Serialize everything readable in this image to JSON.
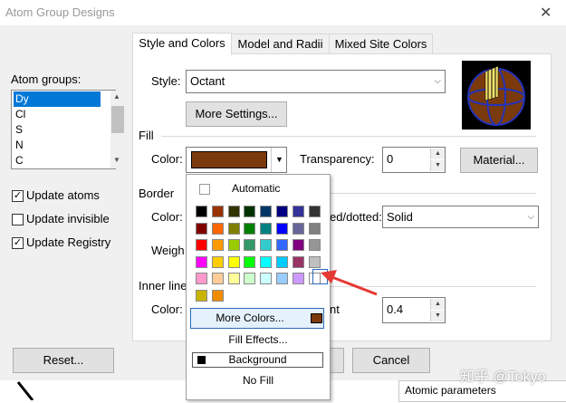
{
  "window": {
    "title": "Atom Group Designs",
    "close_icon": "close-icon"
  },
  "tabs": [
    {
      "label": "Style and Colors",
      "active": true
    },
    {
      "label": "Model and Radii",
      "active": false
    },
    {
      "label": "Mixed Site Colors",
      "active": false
    }
  ],
  "left": {
    "atom_groups_label": "Atom groups:",
    "groups": [
      "Dy",
      "Cl",
      "S",
      "N",
      "C"
    ],
    "selected_group": "Dy",
    "checkboxes": [
      {
        "label": "Update atoms",
        "checked": true
      },
      {
        "label": "Update invisible",
        "checked": false
      },
      {
        "label": "Update Registry",
        "checked": true
      }
    ],
    "reset_button": "Reset..."
  },
  "style": {
    "label": "Style:",
    "value": "Octant"
  },
  "more_settings_button": "More Settings...",
  "fill": {
    "section": "Fill",
    "color_label": "Color:",
    "color_value": "#7b3a0b",
    "transparency_label": "Transparency:",
    "transparency_value": "0",
    "material_button": "Material..."
  },
  "border": {
    "section": "Border",
    "color_label": "Color:",
    "dotted_label": "ed/dotted:",
    "dotted_value": "Solid",
    "weight_label": "Weigh"
  },
  "inner_lines": {
    "section": "Inner line",
    "color_label": "Color:",
    "partial_label": "nt",
    "value": "0.4"
  },
  "cancel_button": "Cancel",
  "color_popup": {
    "automatic": "Automatic",
    "rows": [
      [
        "#000000",
        "#993300",
        "#333300",
        "#003300",
        "#003366",
        "#000080",
        "#333399",
        "#333333"
      ],
      [
        "#800000",
        "#ff6600",
        "#808000",
        "#008000",
        "#008080",
        "#0000ff",
        "#666699",
        "#808080"
      ],
      [
        "#ff0000",
        "#ff9900",
        "#99cc00",
        "#339966",
        "#33cccc",
        "#3366ff",
        "#800080",
        "#969696"
      ],
      [
        "#ff00ff",
        "#ffcc00",
        "#ffff00",
        "#00ff00",
        "#00ffff",
        "#00ccff",
        "#993366",
        "#c0c0c0"
      ],
      [
        "#ff99cc",
        "#ffcc99",
        "#ffff99",
        "#ccffcc",
        "#ccffff",
        "#99ccff",
        "#cc99ff",
        "#ffffff"
      ],
      [
        "#c8b400",
        "#f08c00"
      ]
    ],
    "more_colors": "More Colors...",
    "more_colors_swatch": "#7b3a0b",
    "fill_effects": "Fill Effects...",
    "background": "Background",
    "no_fill": "No Fill"
  },
  "taskbar_label": "Atomic parameters",
  "watermark": "知乎 @Tokyo"
}
